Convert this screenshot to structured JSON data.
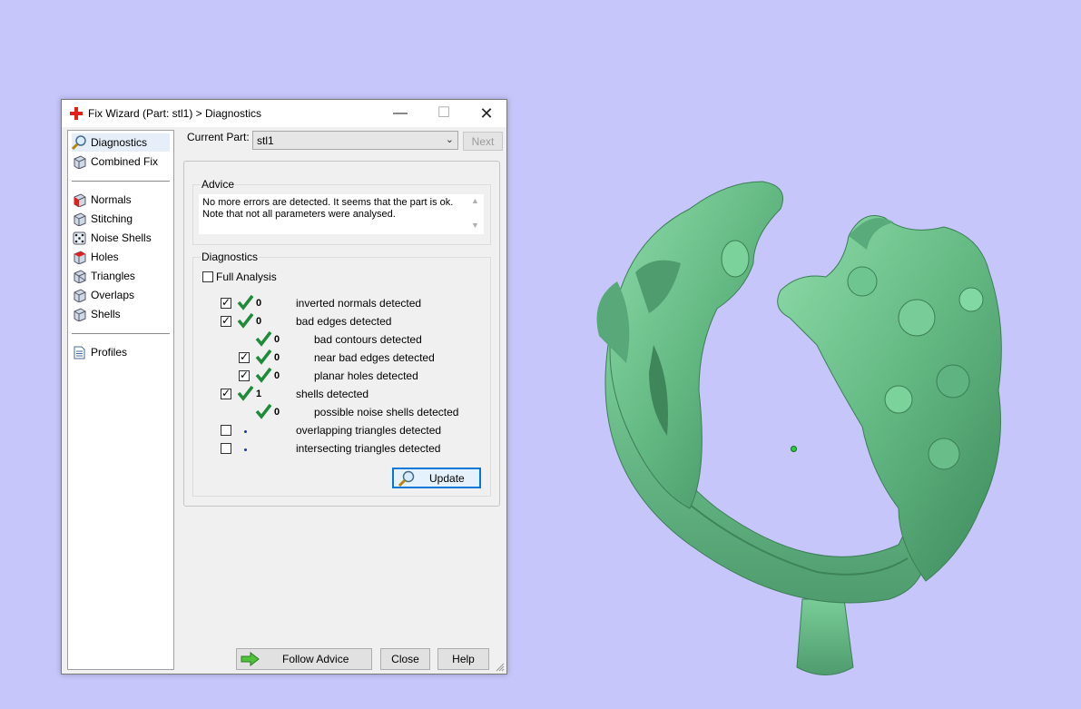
{
  "colors": {
    "background": "#c6c6fb",
    "model": "#6cc28b",
    "accent": "#0078d7",
    "tick": "#1e8a3c"
  },
  "window": {
    "title": "Fix Wizard (Part: stl1) > Diagnostics",
    "controls": {
      "minimize": "—",
      "maximize": "☐",
      "close": "✕"
    }
  },
  "sidebar": {
    "items": [
      {
        "label": "Diagnostics",
        "icon": "magnifier-icon"
      },
      {
        "label": "Combined Fix",
        "icon": "cube-icon"
      },
      {
        "label": "Normals",
        "icon": "cube-red-icon"
      },
      {
        "label": "Stitching",
        "icon": "cube-icon"
      },
      {
        "label": "Noise Shells",
        "icon": "dice-icon"
      },
      {
        "label": "Holes",
        "icon": "cube-red-icon"
      },
      {
        "label": "Triangles",
        "icon": "cube-icon"
      },
      {
        "label": "Overlaps",
        "icon": "cube-icon"
      },
      {
        "label": "Shells",
        "icon": "cube-icon"
      },
      {
        "label": "Profiles",
        "icon": "document-icon"
      }
    ]
  },
  "part": {
    "label": "Current Part:",
    "value": "stl1",
    "next_label": "Next"
  },
  "advice": {
    "title": "Advice",
    "lines": [
      "No more errors are detected. It seems that the part is ok.",
      "Note that not all parameters were analysed."
    ]
  },
  "diagnostics": {
    "title": "Diagnostics",
    "full_analysis_label": "Full Analysis",
    "rows": [
      {
        "count": "0",
        "label": "inverted normals detected",
        "checked": true,
        "indent": false
      },
      {
        "count": "0",
        "label": "bad edges detected",
        "checked": true,
        "indent": false
      },
      {
        "count": "0",
        "label": "bad contours detected",
        "checked": null,
        "indent": true
      },
      {
        "count": "0",
        "label": "near bad edges detected",
        "checked": true,
        "indent": true
      },
      {
        "count": "0",
        "label": "planar holes detected",
        "checked": true,
        "indent": true
      },
      {
        "count": "1",
        "label": "shells detected",
        "checked": true,
        "indent": false
      },
      {
        "count": "0",
        "label": "possible noise shells detected",
        "checked": null,
        "indent": true
      },
      {
        "count": "",
        "label": "overlapping triangles detected",
        "checked": false,
        "indent": false
      },
      {
        "count": "",
        "label": "intersecting triangles detected",
        "checked": false,
        "indent": false
      }
    ],
    "update_label": "Update"
  },
  "footer": {
    "follow_label": "Follow Advice",
    "close_label": "Close",
    "help_label": "Help"
  }
}
